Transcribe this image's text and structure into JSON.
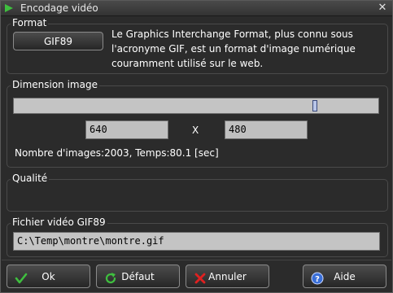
{
  "window": {
    "title": "Encodage vidéo",
    "icon": "video-encode-icon",
    "close_glyph": "✕"
  },
  "format": {
    "label": "Format",
    "button_label": "GIF89",
    "description": "Le Graphics Interchange Format, plus connu sous l'acronyme GIF, est un format d'image numérique couramment utilisé sur le web."
  },
  "dimension": {
    "label": "Dimension image",
    "slider_value_fraction": 0.83,
    "width_value": "640",
    "separator": "X",
    "height_value": "480",
    "info": "Nombre d'images:2003, Temps:80.1 [sec]"
  },
  "quality": {
    "label": "Qualité"
  },
  "output_file": {
    "label": "Fichier vidéo GIF89",
    "path": "C:\\Temp\\montre\\montre.gif"
  },
  "buttons": {
    "ok": "Ok",
    "default": "Défaut",
    "cancel": "Annuler",
    "help": "Aide"
  },
  "colors": {
    "ok_icon": "#3fbf3f",
    "default_icon": "#3fbf3f",
    "cancel_icon": "#e02020",
    "help_icon": "#3a6fd8"
  }
}
